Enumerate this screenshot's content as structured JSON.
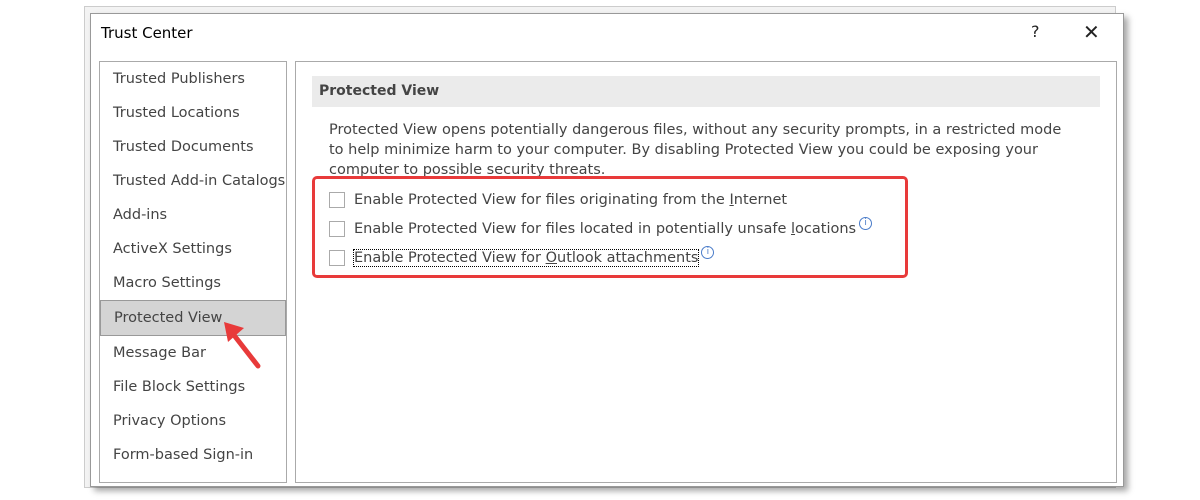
{
  "dialog": {
    "title": "Trust Center",
    "help_label": "?",
    "close_label": "✕"
  },
  "sidebar": {
    "items": [
      {
        "label": "Trusted Publishers"
      },
      {
        "label": "Trusted Locations"
      },
      {
        "label": "Trusted Documents"
      },
      {
        "label": "Trusted Add-in Catalogs"
      },
      {
        "label": "Add-ins"
      },
      {
        "label": "ActiveX Settings"
      },
      {
        "label": "Macro Settings"
      },
      {
        "label": "Protected View",
        "selected": true
      },
      {
        "label": "Message Bar"
      },
      {
        "label": "File Block Settings"
      },
      {
        "label": "Privacy Options"
      },
      {
        "label": "Form-based Sign-in"
      }
    ]
  },
  "main": {
    "section_title": "Protected View",
    "description": "Protected View opens potentially dangerous files, without any security prompts, in a restricted mode to help minimize harm to your computer. By disabling Protected View you could be exposing your computer to possible security threats.",
    "options": [
      {
        "pre": "Enable Protected View for files originating from the ",
        "key": "I",
        "post": "nternet",
        "checked": false,
        "info": false
      },
      {
        "pre": "Enable Protected View for files located in potentially unsafe ",
        "key": "l",
        "post": "ocations",
        "checked": false,
        "info": true
      },
      {
        "pre": "Enable Protected View for ",
        "key": "O",
        "post": "utlook attachments",
        "checked": false,
        "info": true
      }
    ],
    "info_icon": "info-circle-icon"
  },
  "annotation": {
    "highlight_color": "#e83a3a",
    "arrow_color": "#e83a3a"
  }
}
